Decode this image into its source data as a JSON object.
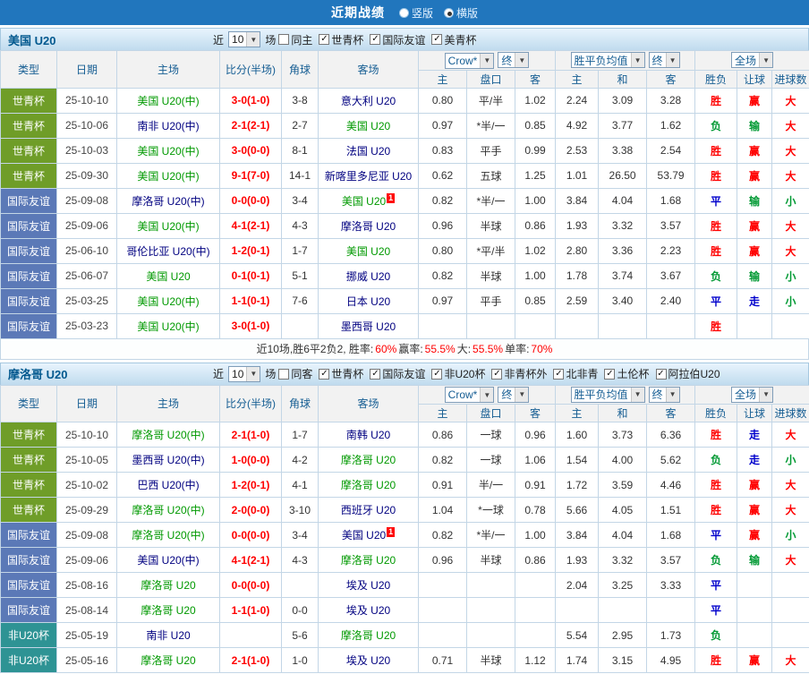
{
  "topbar": {
    "title": "近期战绩",
    "layout_options": [
      {
        "label": "竖版",
        "selected": false
      },
      {
        "label": "横版",
        "selected": true
      }
    ]
  },
  "table_header": {
    "type": "类型",
    "date": "日期",
    "home": "主场",
    "score": "比分(半场)",
    "corner": "角球",
    "away": "客场",
    "odds_select": "Crow*",
    "odds_stage_select": "终",
    "avg_select": "胜平负均值",
    "avg_stage_select": "终",
    "scope_select": "全场",
    "sub": [
      "主",
      "盘口",
      "客",
      "主",
      "和",
      "客",
      "胜负",
      "让球",
      "进球数"
    ]
  },
  "type_colors": {
    "世青杯": "green",
    "国际友谊": "blue",
    "非U20杯": "teal"
  },
  "sections": [
    {
      "team": "美国 U20",
      "filter": {
        "near": "近",
        "count": "10",
        "games": "场",
        "checkboxes": [
          {
            "label": "同主",
            "checked": false
          },
          {
            "label": "世青杯",
            "checked": true
          },
          {
            "label": "国际友谊",
            "checked": true
          },
          {
            "label": "美青杯",
            "checked": true
          }
        ]
      },
      "rows": [
        {
          "type": "世青杯",
          "date": "25-10-10",
          "home": "美国 U20(中)",
          "home_team": true,
          "score": "3-0(1-0)",
          "corner": "3-8",
          "away": "意大利 U20",
          "away_team": false,
          "away_redcard": "",
          "odds": [
            "0.80",
            "平/半",
            "1.02"
          ],
          "avg": [
            "2.24",
            "3.09",
            "3.28"
          ],
          "results": [
            {
              "t": "胜",
              "c": "red"
            },
            {
              "t": "赢",
              "c": "red"
            },
            {
              "t": "大",
              "c": "red"
            }
          ]
        },
        {
          "type": "世青杯",
          "date": "25-10-06",
          "home": "南非 U20(中)",
          "home_team": false,
          "score": "2-1(2-1)",
          "corner": "2-7",
          "away": "美国 U20",
          "away_team": true,
          "away_redcard": "",
          "odds": [
            "0.97",
            "*半/一",
            "0.85"
          ],
          "avg": [
            "4.92",
            "3.77",
            "1.62"
          ],
          "results": [
            {
              "t": "负",
              "c": "green"
            },
            {
              "t": "输",
              "c": "green"
            },
            {
              "t": "大",
              "c": "red"
            }
          ]
        },
        {
          "type": "世青杯",
          "date": "25-10-03",
          "home": "美国 U20(中)",
          "home_team": true,
          "score": "3-0(0-0)",
          "corner": "8-1",
          "away": "法国 U20",
          "away_team": false,
          "away_redcard": "",
          "odds": [
            "0.83",
            "平手",
            "0.99"
          ],
          "avg": [
            "2.53",
            "3.38",
            "2.54"
          ],
          "results": [
            {
              "t": "胜",
              "c": "red"
            },
            {
              "t": "赢",
              "c": "red"
            },
            {
              "t": "大",
              "c": "red"
            }
          ]
        },
        {
          "type": "世青杯",
          "date": "25-09-30",
          "home": "美国 U20(中)",
          "home_team": true,
          "score": "9-1(7-0)",
          "corner": "14-1",
          "away": "新喀里多尼亚 U20",
          "away_team": false,
          "away_redcard": "",
          "odds": [
            "0.62",
            "五球",
            "1.25"
          ],
          "avg": [
            "1.01",
            "26.50",
            "53.79"
          ],
          "results": [
            {
              "t": "胜",
              "c": "red"
            },
            {
              "t": "赢",
              "c": "red"
            },
            {
              "t": "大",
              "c": "red"
            }
          ]
        },
        {
          "type": "国际友谊",
          "date": "25-09-08",
          "home": "摩洛哥 U20(中)",
          "home_team": false,
          "score": "0-0(0-0)",
          "corner": "3-4",
          "away": "美国 U20",
          "away_team": true,
          "away_redcard": "1",
          "odds": [
            "0.82",
            "*半/一",
            "1.00"
          ],
          "avg": [
            "3.84",
            "4.04",
            "1.68"
          ],
          "results": [
            {
              "t": "平",
              "c": "blue"
            },
            {
              "t": "输",
              "c": "green"
            },
            {
              "t": "小",
              "c": "green"
            }
          ]
        },
        {
          "type": "国际友谊",
          "date": "25-09-06",
          "home": "美国 U20(中)",
          "home_team": true,
          "score": "4-1(2-1)",
          "corner": "4-3",
          "away": "摩洛哥 U20",
          "away_team": false,
          "away_redcard": "",
          "odds": [
            "0.96",
            "半球",
            "0.86"
          ],
          "avg": [
            "1.93",
            "3.32",
            "3.57"
          ],
          "results": [
            {
              "t": "胜",
              "c": "red"
            },
            {
              "t": "赢",
              "c": "red"
            },
            {
              "t": "大",
              "c": "red"
            }
          ]
        },
        {
          "type": "国际友谊",
          "date": "25-06-10",
          "home": "哥伦比亚 U20(中)",
          "home_team": false,
          "score": "1-2(0-1)",
          "corner": "1-7",
          "away": "美国 U20",
          "away_team": true,
          "away_redcard": "",
          "odds": [
            "0.80",
            "*平/半",
            "1.02"
          ],
          "avg": [
            "2.80",
            "3.36",
            "2.23"
          ],
          "results": [
            {
              "t": "胜",
              "c": "red"
            },
            {
              "t": "赢",
              "c": "red"
            },
            {
              "t": "大",
              "c": "red"
            }
          ]
        },
        {
          "type": "国际友谊",
          "date": "25-06-07",
          "home": "美国 U20",
          "home_team": true,
          "score": "0-1(0-1)",
          "corner": "5-1",
          "away": "挪威 U20",
          "away_team": false,
          "away_redcard": "",
          "odds": [
            "0.82",
            "半球",
            "1.00"
          ],
          "avg": [
            "1.78",
            "3.74",
            "3.67"
          ],
          "results": [
            {
              "t": "负",
              "c": "green"
            },
            {
              "t": "输",
              "c": "green"
            },
            {
              "t": "小",
              "c": "green"
            }
          ]
        },
        {
          "type": "国际友谊",
          "date": "25-03-25",
          "home": "美国 U20(中)",
          "home_team": true,
          "score": "1-1(0-1)",
          "corner": "7-6",
          "away": "日本 U20",
          "away_team": false,
          "away_redcard": "",
          "odds": [
            "0.97",
            "平手",
            "0.85"
          ],
          "avg": [
            "2.59",
            "3.40",
            "2.40"
          ],
          "results": [
            {
              "t": "平",
              "c": "blue"
            },
            {
              "t": "走",
              "c": "blue"
            },
            {
              "t": "小",
              "c": "green"
            }
          ]
        },
        {
          "type": "国际友谊",
          "date": "25-03-23",
          "home": "美国 U20(中)",
          "home_team": true,
          "score": "3-0(1-0)",
          "corner": "",
          "away": "墨西哥 U20",
          "away_team": false,
          "away_redcard": "",
          "odds": [
            "",
            "",
            ""
          ],
          "avg": [
            "",
            "",
            ""
          ],
          "results": [
            {
              "t": "胜",
              "c": "red"
            },
            {
              "t": "",
              "c": ""
            },
            {
              "t": "",
              "c": ""
            }
          ]
        }
      ],
      "summary": [
        {
          "text": "近10场,胜6平2负2, 胜率:",
          "red": false
        },
        {
          "text": "60%",
          "red": true
        },
        {
          "text": " 赢率:",
          "red": false
        },
        {
          "text": "55.5%",
          "red": true
        },
        {
          "text": " 大:",
          "red": false
        },
        {
          "text": "55.5%",
          "red": true
        },
        {
          "text": " 单率:",
          "red": false
        },
        {
          "text": "70%",
          "red": true
        }
      ]
    },
    {
      "team": "摩洛哥 U20",
      "filter": {
        "near": "近",
        "count": "10",
        "games": "场",
        "checkboxes": [
          {
            "label": "同客",
            "checked": false
          },
          {
            "label": "世青杯",
            "checked": true
          },
          {
            "label": "国际友谊",
            "checked": true
          },
          {
            "label": "非U20杯",
            "checked": true
          },
          {
            "label": "非青杯外",
            "checked": true
          },
          {
            "label": "北非青",
            "checked": true
          },
          {
            "label": "土伦杯",
            "checked": true
          },
          {
            "label": "阿拉伯U20",
            "checked": true
          }
        ]
      },
      "rows": [
        {
          "type": "世青杯",
          "date": "25-10-10",
          "home": "摩洛哥 U20(中)",
          "home_team": true,
          "score": "2-1(1-0)",
          "corner": "1-7",
          "away": "南韩 U20",
          "away_team": false,
          "away_redcard": "",
          "odds": [
            "0.86",
            "一球",
            "0.96"
          ],
          "avg": [
            "1.60",
            "3.73",
            "6.36"
          ],
          "results": [
            {
              "t": "胜",
              "c": "red"
            },
            {
              "t": "走",
              "c": "blue"
            },
            {
              "t": "大",
              "c": "red"
            }
          ]
        },
        {
          "type": "世青杯",
          "date": "25-10-05",
          "home": "墨西哥 U20(中)",
          "home_team": false,
          "score": "1-0(0-0)",
          "corner": "4-2",
          "away": "摩洛哥 U20",
          "away_team": true,
          "away_redcard": "",
          "odds": [
            "0.82",
            "一球",
            "1.06"
          ],
          "avg": [
            "1.54",
            "4.00",
            "5.62"
          ],
          "results": [
            {
              "t": "负",
              "c": "green"
            },
            {
              "t": "走",
              "c": "blue"
            },
            {
              "t": "小",
              "c": "green"
            }
          ]
        },
        {
          "type": "世青杯",
          "date": "25-10-02",
          "home": "巴西 U20(中)",
          "home_team": false,
          "score": "1-2(0-1)",
          "corner": "4-1",
          "away": "摩洛哥 U20",
          "away_team": true,
          "away_redcard": "",
          "odds": [
            "0.91",
            "半/一",
            "0.91"
          ],
          "avg": [
            "1.72",
            "3.59",
            "4.46"
          ],
          "results": [
            {
              "t": "胜",
              "c": "red"
            },
            {
              "t": "赢",
              "c": "red"
            },
            {
              "t": "大",
              "c": "red"
            }
          ]
        },
        {
          "type": "世青杯",
          "date": "25-09-29",
          "home": "摩洛哥 U20(中)",
          "home_team": true,
          "score": "2-0(0-0)",
          "corner": "3-10",
          "away": "西班牙 U20",
          "away_team": false,
          "away_redcard": "",
          "odds": [
            "1.04",
            "*一球",
            "0.78"
          ],
          "avg": [
            "5.66",
            "4.05",
            "1.51"
          ],
          "results": [
            {
              "t": "胜",
              "c": "red"
            },
            {
              "t": "赢",
              "c": "red"
            },
            {
              "t": "大",
              "c": "red"
            }
          ]
        },
        {
          "type": "国际友谊",
          "date": "25-09-08",
          "home": "摩洛哥 U20(中)",
          "home_team": true,
          "score": "0-0(0-0)",
          "corner": "3-4",
          "away": "美国 U20",
          "away_team": false,
          "away_redcard": "1",
          "odds": [
            "0.82",
            "*半/一",
            "1.00"
          ],
          "avg": [
            "3.84",
            "4.04",
            "1.68"
          ],
          "results": [
            {
              "t": "平",
              "c": "blue"
            },
            {
              "t": "赢",
              "c": "red"
            },
            {
              "t": "小",
              "c": "green"
            }
          ]
        },
        {
          "type": "国际友谊",
          "date": "25-09-06",
          "home": "美国 U20(中)",
          "home_team": false,
          "score": "4-1(2-1)",
          "corner": "4-3",
          "away": "摩洛哥 U20",
          "away_team": true,
          "away_redcard": "",
          "odds": [
            "0.96",
            "半球",
            "0.86"
          ],
          "avg": [
            "1.93",
            "3.32",
            "3.57"
          ],
          "results": [
            {
              "t": "负",
              "c": "green"
            },
            {
              "t": "输",
              "c": "green"
            },
            {
              "t": "大",
              "c": "red"
            }
          ]
        },
        {
          "type": "国际友谊",
          "date": "25-08-16",
          "home": "摩洛哥 U20",
          "home_team": true,
          "score": "0-0(0-0)",
          "corner": "",
          "away": "埃及 U20",
          "away_team": false,
          "away_redcard": "",
          "odds": [
            "",
            "",
            ""
          ],
          "avg": [
            "2.04",
            "3.25",
            "3.33"
          ],
          "results": [
            {
              "t": "平",
              "c": "blue"
            },
            {
              "t": "",
              "c": ""
            },
            {
              "t": "",
              "c": ""
            }
          ]
        },
        {
          "type": "国际友谊",
          "date": "25-08-14",
          "home": "摩洛哥 U20",
          "home_team": true,
          "score": "1-1(1-0)",
          "corner": "0-0",
          "away": "埃及 U20",
          "away_team": false,
          "away_redcard": "",
          "odds": [
            "",
            "",
            ""
          ],
          "avg": [
            "",
            "",
            ""
          ],
          "results": [
            {
              "t": "平",
              "c": "blue"
            },
            {
              "t": "",
              "c": ""
            },
            {
              "t": "",
              "c": ""
            }
          ]
        },
        {
          "type": "非U20杯",
          "date": "25-05-19",
          "home": "南非 U20",
          "home_team": false,
          "score": "",
          "corner": "5-6",
          "away": "摩洛哥 U20",
          "away_team": true,
          "away_redcard": "",
          "odds": [
            "",
            "",
            ""
          ],
          "avg": [
            "5.54",
            "2.95",
            "1.73"
          ],
          "results": [
            {
              "t": "负",
              "c": "green"
            },
            {
              "t": "",
              "c": ""
            },
            {
              "t": "",
              "c": ""
            }
          ]
        },
        {
          "type": "非U20杯",
          "date": "25-05-16",
          "home": "摩洛哥 U20",
          "home_team": true,
          "score": "2-1(1-0)",
          "corner": "1-0",
          "away": "埃及 U20",
          "away_team": false,
          "away_redcard": "",
          "odds": [
            "0.71",
            "半球",
            "1.12"
          ],
          "avg": [
            "1.74",
            "3.15",
            "4.95"
          ],
          "results": [
            {
              "t": "胜",
              "c": "red"
            },
            {
              "t": "赢",
              "c": "red"
            },
            {
              "t": "大",
              "c": "red"
            }
          ]
        }
      ],
      "summary": null
    }
  ]
}
